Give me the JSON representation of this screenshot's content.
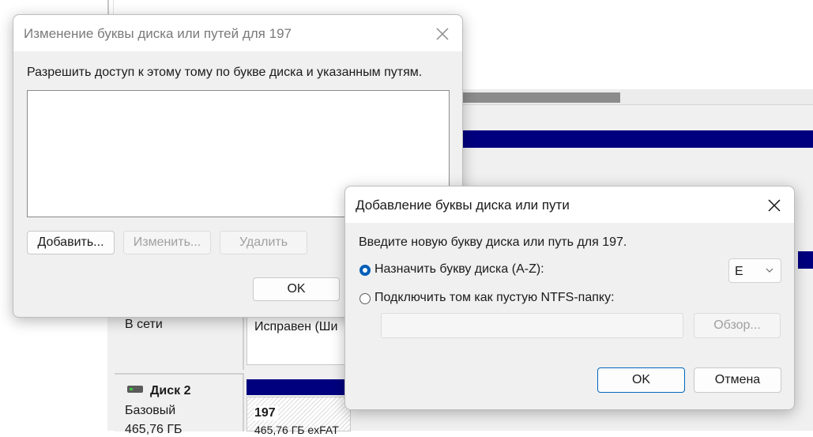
{
  "background": {
    "status_online": "В сети",
    "status_healthy": "Исправен (Ши",
    "disk2_name": "Диск 2",
    "disk2_type": "Базовый",
    "disk2_size": "465,76 ГБ",
    "partition_label": "197",
    "partition_info": "465,76 ГБ exFAT",
    "colors": {
      "partition_bar": "#00007f",
      "panel": "#f0f0f0"
    }
  },
  "change_dialog": {
    "title": "Изменение буквы диска или путей для 197",
    "description": "Разрешить доступ к этому тому по букве диска и указанным путям.",
    "paths_list": [],
    "add_label": "Добавить...",
    "change_label": "Изменить...",
    "delete_label": "Удалить",
    "ok_label": "OK"
  },
  "add_dialog": {
    "title": "Добавление буквы диска или пути",
    "prompt": "Введите новую букву диска или путь для 197.",
    "assign_letter_label": "Назначить букву диска (A-Z):",
    "assign_letter_selected": true,
    "letter_value": "E",
    "mount_folder_label": "Подключить том как пустую NTFS-папку:",
    "mount_folder_selected": false,
    "folder_path_value": "",
    "browse_label": "Обзор...",
    "ok_label": "OK",
    "cancel_label": "Отмена",
    "colors": {
      "accent": "#005fb8"
    }
  }
}
